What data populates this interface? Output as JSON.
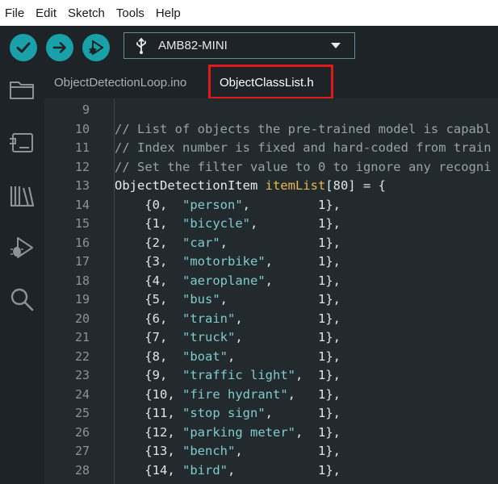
{
  "menu": [
    "File",
    "Edit",
    "Sketch",
    "Tools",
    "Help"
  ],
  "toolbar": {
    "verify_icon": "check-icon",
    "upload_icon": "arrow-right-icon",
    "debug_icon": "debug-icon",
    "board": "AMB82-MINI",
    "board_icon": "usb-icon",
    "dropdown_icon": "caret-down-icon"
  },
  "sidebar": [
    "folder-icon",
    "board-manager-icon",
    "library-icon",
    "debug-icon",
    "search-icon"
  ],
  "tabs": [
    "ObjectDetectionLoop.ino",
    "ObjectClassList.h"
  ],
  "active_tab": "ObjectClassList.h",
  "colors": {
    "accent": "#1aa0a8",
    "highlight_box": "#e01a1a",
    "comment": "#95a3a8",
    "identifier": "#e7b94a",
    "string": "#7fcbcd"
  },
  "code": {
    "lines": [
      {
        "n": "9",
        "segs": []
      },
      {
        "n": "10",
        "segs": [
          {
            "c": "c-comment",
            "t": "// List of objects the pre-trained model is capabl"
          }
        ]
      },
      {
        "n": "11",
        "segs": [
          {
            "c": "c-comment",
            "t": "// Index number is fixed and hard-coded from train"
          }
        ]
      },
      {
        "n": "12",
        "segs": [
          {
            "c": "c-comment",
            "t": "// Set the filter value to 0 to ignore any recogni"
          }
        ]
      },
      {
        "n": "13",
        "segs": [
          {
            "c": "c-type",
            "t": "ObjectDetectionItem "
          },
          {
            "c": "c-var",
            "t": "itemList"
          },
          {
            "c": "c-num",
            "t": "[80] = {"
          }
        ]
      },
      {
        "n": "14",
        "segs": [
          {
            "c": "c-num",
            "t": "    {0,  "
          },
          {
            "c": "c-str",
            "t": "\"person\""
          },
          {
            "c": "c-num",
            "t": ",         1},"
          }
        ]
      },
      {
        "n": "15",
        "segs": [
          {
            "c": "c-num",
            "t": "    {1,  "
          },
          {
            "c": "c-str",
            "t": "\"bicycle\""
          },
          {
            "c": "c-num",
            "t": ",        1},"
          }
        ]
      },
      {
        "n": "16",
        "segs": [
          {
            "c": "c-num",
            "t": "    {2,  "
          },
          {
            "c": "c-str",
            "t": "\"car\""
          },
          {
            "c": "c-num",
            "t": ",            1},"
          }
        ]
      },
      {
        "n": "17",
        "segs": [
          {
            "c": "c-num",
            "t": "    {3,  "
          },
          {
            "c": "c-str",
            "t": "\"motorbike\""
          },
          {
            "c": "c-num",
            "t": ",      1},"
          }
        ]
      },
      {
        "n": "18",
        "segs": [
          {
            "c": "c-num",
            "t": "    {4,  "
          },
          {
            "c": "c-str",
            "t": "\"aeroplane\""
          },
          {
            "c": "c-num",
            "t": ",      1},"
          }
        ]
      },
      {
        "n": "19",
        "segs": [
          {
            "c": "c-num",
            "t": "    {5,  "
          },
          {
            "c": "c-str",
            "t": "\"bus\""
          },
          {
            "c": "c-num",
            "t": ",            1},"
          }
        ]
      },
      {
        "n": "20",
        "segs": [
          {
            "c": "c-num",
            "t": "    {6,  "
          },
          {
            "c": "c-str",
            "t": "\"train\""
          },
          {
            "c": "c-num",
            "t": ",          1},"
          }
        ]
      },
      {
        "n": "21",
        "segs": [
          {
            "c": "c-num",
            "t": "    {7,  "
          },
          {
            "c": "c-str",
            "t": "\"truck\""
          },
          {
            "c": "c-num",
            "t": ",          1},"
          }
        ]
      },
      {
        "n": "22",
        "segs": [
          {
            "c": "c-num",
            "t": "    {8,  "
          },
          {
            "c": "c-str",
            "t": "\"boat\""
          },
          {
            "c": "c-num",
            "t": ",           1},"
          }
        ]
      },
      {
        "n": "23",
        "segs": [
          {
            "c": "c-num",
            "t": "    {9,  "
          },
          {
            "c": "c-str",
            "t": "\"traffic light\""
          },
          {
            "c": "c-num",
            "t": ",  1},"
          }
        ]
      },
      {
        "n": "24",
        "segs": [
          {
            "c": "c-num",
            "t": "    {10, "
          },
          {
            "c": "c-str",
            "t": "\"fire hydrant\""
          },
          {
            "c": "c-num",
            "t": ",   1},"
          }
        ]
      },
      {
        "n": "25",
        "segs": [
          {
            "c": "c-num",
            "t": "    {11, "
          },
          {
            "c": "c-str",
            "t": "\"stop sign\""
          },
          {
            "c": "c-num",
            "t": ",      1},"
          }
        ]
      },
      {
        "n": "26",
        "segs": [
          {
            "c": "c-num",
            "t": "    {12, "
          },
          {
            "c": "c-str",
            "t": "\"parking meter\""
          },
          {
            "c": "c-num",
            "t": ",  1},"
          }
        ]
      },
      {
        "n": "27",
        "segs": [
          {
            "c": "c-num",
            "t": "    {13, "
          },
          {
            "c": "c-str",
            "t": "\"bench\""
          },
          {
            "c": "c-num",
            "t": ",          1},"
          }
        ]
      },
      {
        "n": "28",
        "segs": [
          {
            "c": "c-num",
            "t": "    {14, "
          },
          {
            "c": "c-str",
            "t": "\"bird\""
          },
          {
            "c": "c-num",
            "t": ",           1},"
          }
        ]
      }
    ]
  }
}
